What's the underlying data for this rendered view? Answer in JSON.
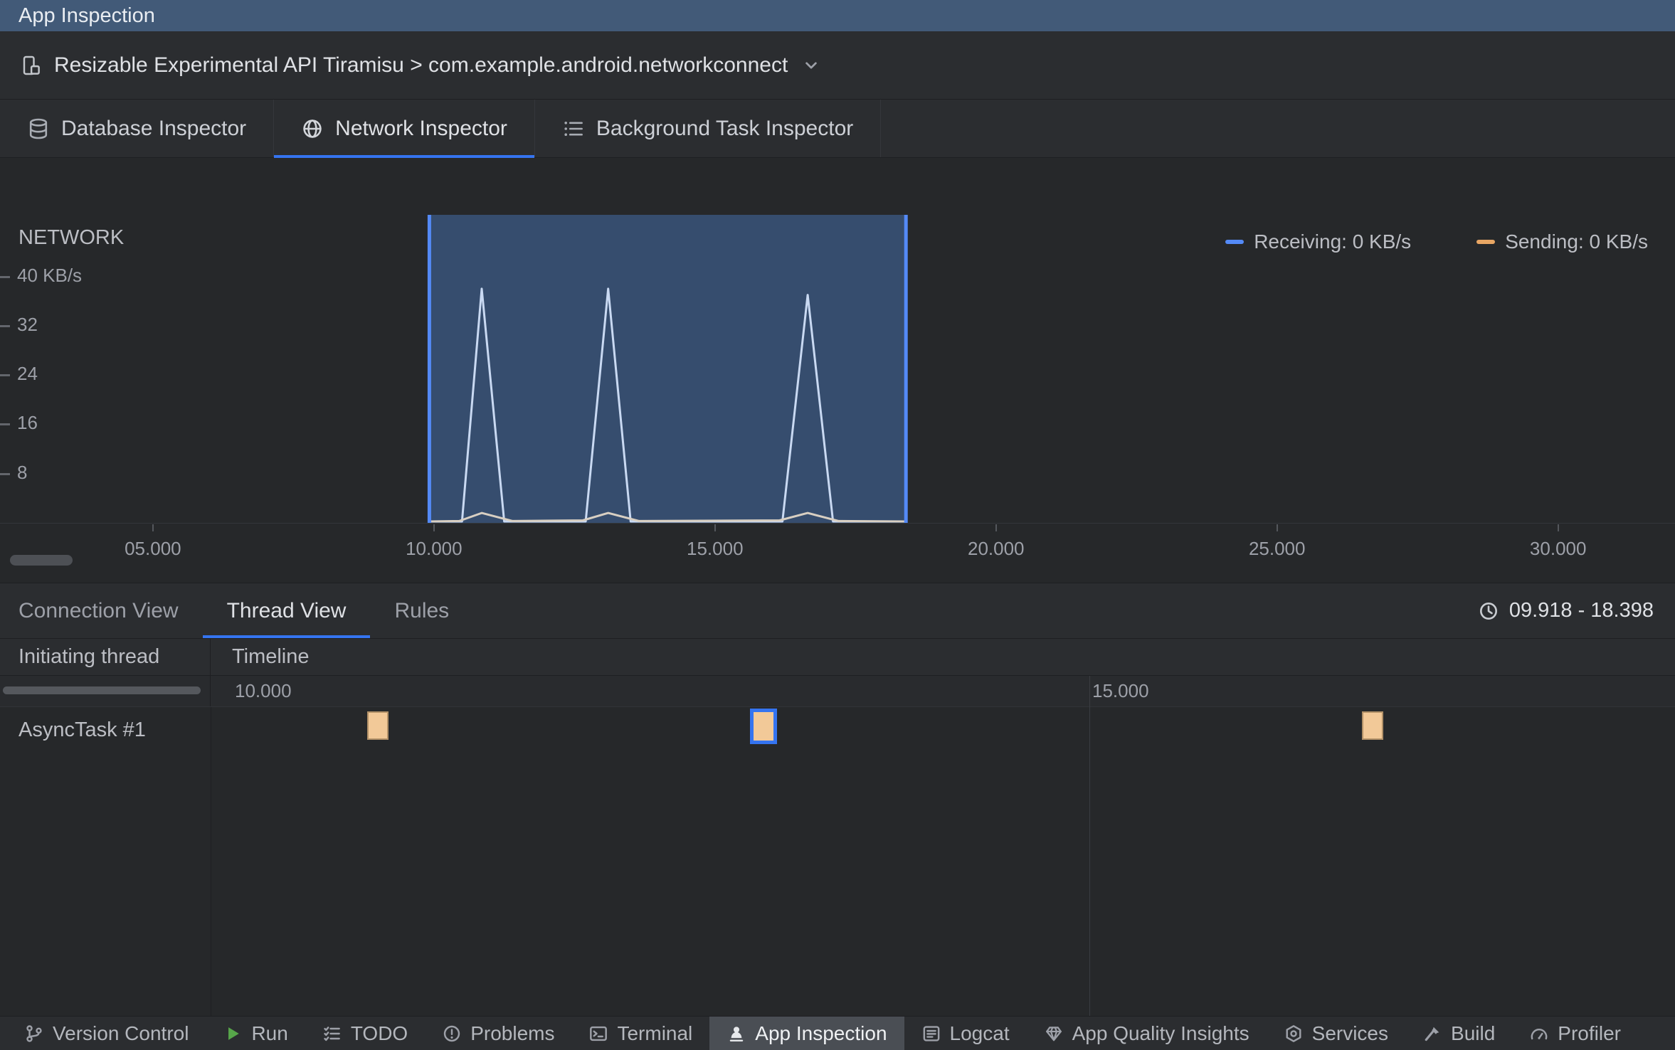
{
  "titlebar": {
    "title": "App Inspection"
  },
  "process_selector": {
    "label": "Resizable Experimental API Tiramisu > com.example.android.networkconnect"
  },
  "inspector_tabs": [
    {
      "label": "Database Inspector",
      "active": false
    },
    {
      "label": "Network Inspector",
      "active": true
    },
    {
      "label": "Background Task Inspector",
      "active": false
    }
  ],
  "chart_data": {
    "type": "area",
    "title": "NETWORK",
    "x_unit": "seconds",
    "y_unit": "KB/s",
    "legend": [
      {
        "label": "Receiving: 0 KB/s",
        "color": "#548AF7"
      },
      {
        "label": "Sending: 0 KB/s",
        "color": "#E8A664"
      }
    ],
    "y_ticks": [
      {
        "v": 40,
        "label": "40 KB/s"
      },
      {
        "v": 32,
        "label": "32"
      },
      {
        "v": 24,
        "label": "24"
      },
      {
        "v": 16,
        "label": "16"
      },
      {
        "v": 8,
        "label": "8"
      }
    ],
    "x_ticks": [
      {
        "t": 5,
        "label": "05.000"
      },
      {
        "t": 10,
        "label": "10.000"
      },
      {
        "t": 15,
        "label": "15.000"
      },
      {
        "t": 20,
        "label": "20.000"
      },
      {
        "t": 25,
        "label": "25.000"
      },
      {
        "t": 30,
        "label": "30.000"
      }
    ],
    "xlim": [
      2.28,
      32.08
    ],
    "ylim": [
      0,
      50
    ],
    "selection": {
      "start": 9.918,
      "end": 18.398,
      "fill": "rgba(76,122,194,0.45)",
      "border": "#548AF7"
    },
    "series": [
      {
        "name": "Receiving",
        "color": "#C9D9F2",
        "points": [
          [
            9.918,
            0
          ],
          [
            10.5,
            0
          ],
          [
            10.85,
            38
          ],
          [
            11.25,
            0
          ],
          [
            12.7,
            0
          ],
          [
            13.1,
            38
          ],
          [
            13.5,
            0
          ],
          [
            16.2,
            0
          ],
          [
            16.65,
            37
          ],
          [
            17.1,
            0
          ],
          [
            18.398,
            0
          ]
        ]
      },
      {
        "name": "Sending",
        "color": "#D8CFC2",
        "points": [
          [
            9.918,
            0.2
          ],
          [
            10.45,
            0.3
          ],
          [
            10.85,
            1.6
          ],
          [
            11.4,
            0.3
          ],
          [
            12.65,
            0.4
          ],
          [
            13.1,
            1.6
          ],
          [
            13.65,
            0.3
          ],
          [
            16.15,
            0.4
          ],
          [
            16.65,
            1.6
          ],
          [
            17.2,
            0.3
          ],
          [
            18.398,
            0.2
          ]
        ]
      }
    ]
  },
  "thread_panel": {
    "tabs": [
      {
        "label": "Connection View",
        "active": false
      },
      {
        "label": "Thread View",
        "active": true
      },
      {
        "label": "Rules",
        "active": false
      }
    ],
    "range_label": "09.918 - 18.398",
    "columns": {
      "thread": "Initiating thread",
      "timeline": "Timeline"
    },
    "time_markers": [
      {
        "t": 10,
        "label": "10.000"
      },
      {
        "t": 15,
        "label": "15.000"
      }
    ],
    "rows": [
      {
        "thread": "AsyncTask #1",
        "event_color": "#F2C998",
        "selected_border": "#3574F0",
        "events": [
          {
            "t": 10.85,
            "selected": false
          },
          {
            "t": 13.1,
            "selected": true
          },
          {
            "t": 16.65,
            "selected": false
          }
        ]
      }
    ]
  },
  "status_bar": {
    "items": [
      {
        "label": "Version Control",
        "icon": "branch-icon",
        "active": false
      },
      {
        "label": "Run",
        "icon": "play-icon",
        "active": false
      },
      {
        "label": "TODO",
        "icon": "todo-list-icon",
        "active": false
      },
      {
        "label": "Problems",
        "icon": "problems-icon",
        "active": false
      },
      {
        "label": "Terminal",
        "icon": "terminal-icon",
        "active": false
      },
      {
        "label": "App Inspection",
        "icon": "app-inspection-icon",
        "active": true
      },
      {
        "label": "Logcat",
        "icon": "logcat-icon",
        "active": false
      },
      {
        "label": "App Quality Insights",
        "icon": "gem-icon",
        "active": false
      },
      {
        "label": "Services",
        "icon": "services-icon",
        "active": false
      },
      {
        "label": "Build",
        "icon": "hammer-icon",
        "active": false
      },
      {
        "label": "Profiler",
        "icon": "gauge-icon",
        "active": false
      }
    ]
  }
}
